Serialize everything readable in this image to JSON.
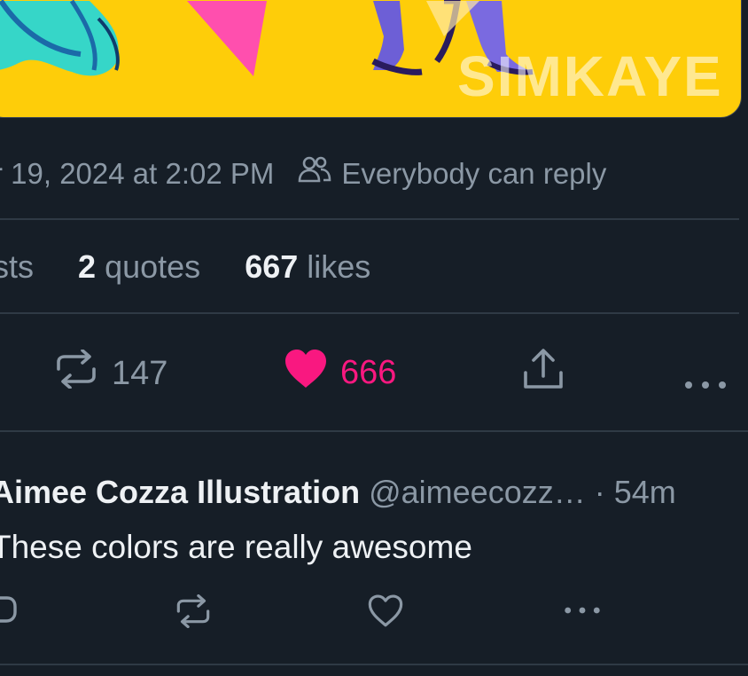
{
  "artwork": {
    "watermark": "SIMKAYE",
    "background_color": "#fecd09"
  },
  "tweet": {
    "timestamp": "r 19, 2024 at 2:02 PM",
    "reply_setting": "Everybody can reply",
    "stats": {
      "reposts_label": "sts",
      "quotes_count": "2",
      "quotes_label": "quotes",
      "likes_count": "667",
      "likes_label": "likes"
    },
    "actions": {
      "repost_count": "147",
      "like_count": "666",
      "liked": true
    }
  },
  "reply": {
    "author_name": "Aimee Cozza Illustration",
    "author_handle": "@aimeecozz…",
    "time": "· 54m",
    "text": "These colors are really awesome"
  },
  "colors": {
    "background": "#161e27",
    "text_primary": "#eef1f4",
    "text_secondary": "#8b98a5",
    "like_pink": "#f91880",
    "divider": "#2f3a45"
  },
  "icons": [
    "people-icon",
    "repost-icon",
    "heart-filled-icon",
    "share-icon",
    "more-icon",
    "reply-icon",
    "heart-outline-icon"
  ]
}
